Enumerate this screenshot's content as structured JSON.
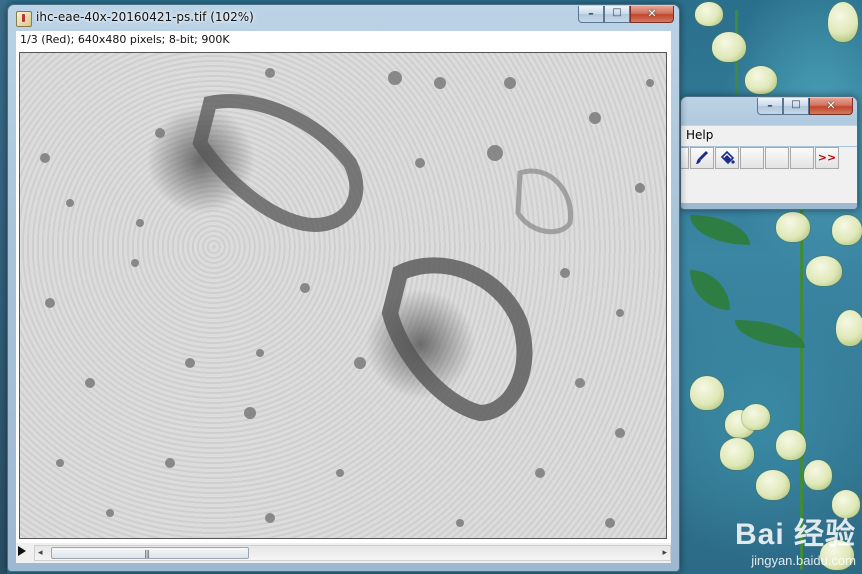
{
  "image_window": {
    "title": "ihc-eae-40x-20160421-ps.tif (102%)",
    "info": "1/3 (Red); 640x480 pixels; 8-bit; 900K",
    "scroll_grip": "|||",
    "scroll_left": "◂",
    "scroll_right": "▸"
  },
  "toolbar_window": {
    "menu_help": "Help",
    "more_tools": ">>"
  },
  "caption": {
    "minimize": "–",
    "maximize": "□",
    "close": "✕"
  },
  "watermark": {
    "brand": "Bai 经验",
    "url": "jingyan.baidu.com"
  },
  "icons": [
    "java-app-icon",
    "paintbrush-icon",
    "flood-fill-icon",
    "play-icon",
    "more-tools-icon"
  ]
}
